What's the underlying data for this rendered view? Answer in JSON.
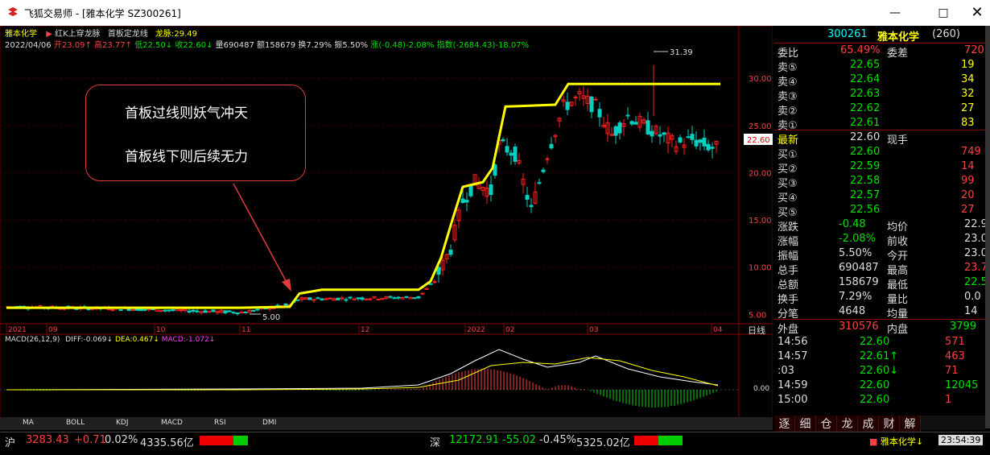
{
  "window": {
    "app_name": "飞狐交易师",
    "title": "飞狐交易师 - [雅本化学 SZ300261]",
    "min_icon": "minimize-icon",
    "max_icon": "maximize-icon",
    "close_icon": "close-icon"
  },
  "header": {
    "stock_name": "雅本化学",
    "signal1": "红K上穿龙脉",
    "signal2": "首板定龙线",
    "dragon_label": "龙脉:29.49",
    "date": "2022/04/06",
    "open": "开23.09↑",
    "high": "高23.77↑",
    "low": "低22.50↓",
    "close": "收22.60↓",
    "volume": "量690487",
    "amount": "额158679",
    "turnover": "换7.29%",
    "amplitude": "振5.50%",
    "change": "涨(-0.48)-2.08%",
    "index": "指数(-2684.43)-18.07%"
  },
  "chart": {
    "price_label": "22.60",
    "high_mark": "31.39",
    "low_mark": "5.00",
    "y_axis": [
      "30.00",
      "25.00",
      "20.00",
      "15.00",
      "10.00",
      "5.00"
    ],
    "x_axis": [
      "2021",
      "09",
      "10",
      "11",
      "12",
      "2022",
      "02",
      "03",
      "04"
    ],
    "period": "日线",
    "line_color": "#ffff00",
    "up_color": "#ff2020",
    "down_color": "#00d0c0"
  },
  "macd": {
    "label": "MACD(26,12,9)",
    "diff": "DIFF:-0.069↓",
    "dea": "DEA:0.467↓",
    "macd": "MACD:-1.072↓",
    "zero": "0.00"
  },
  "annotation": {
    "line1": "首板过线则妖气冲天",
    "line2": "首板线下则后续无力"
  },
  "indicators": [
    "MA",
    "BOLL",
    "KDJ",
    "MACD",
    "RSI",
    "DMI"
  ],
  "quote": {
    "code": "300261",
    "name": "雅本化学",
    "count": "(260)",
    "weibi_label": "委比",
    "weibi": "65.49%",
    "weicha_label": "委差",
    "weicha": "720",
    "sells": [
      {
        "label": "卖⑤",
        "price": "22.65",
        "vol": "19"
      },
      {
        "label": "卖④",
        "price": "22.64",
        "vol": "34"
      },
      {
        "label": "卖③",
        "price": "22.63",
        "vol": "32"
      },
      {
        "label": "卖②",
        "price": "22.62",
        "vol": "27"
      },
      {
        "label": "卖①",
        "price": "22.61",
        "vol": "83"
      }
    ],
    "latest_label": "最新",
    "latest": "22.60",
    "xianshou_label": "现手",
    "buys": [
      {
        "label": "买①",
        "price": "22.60",
        "vol": "749"
      },
      {
        "label": "买②",
        "price": "22.59",
        "vol": "14"
      },
      {
        "label": "买③",
        "price": "22.58",
        "vol": "99"
      },
      {
        "label": "买④",
        "price": "22.57",
        "vol": "20"
      },
      {
        "label": "买⑤",
        "price": "22.56",
        "vol": "27"
      }
    ],
    "stats": [
      {
        "l1": "涨跌",
        "v1": "-0.48",
        "l2": "均价",
        "v2": "22.9"
      },
      {
        "l1": "涨幅",
        "v1": "-2.08%",
        "l2": "前收",
        "v2": "23.0"
      },
      {
        "l1": "振幅",
        "v1": "5.50%",
        "l2": "今开",
        "v2": "23.0"
      },
      {
        "l1": "总手",
        "v1": "690487",
        "l2": "最高",
        "v2": "23.7"
      },
      {
        "l1": "总额",
        "v1": "158679",
        "l2": "最低",
        "v2": "22.5"
      },
      {
        "l1": "换手",
        "v1": "7.29%",
        "l2": "量比",
        "v2": "0.0"
      },
      {
        "l1": "分笔",
        "v1": "4648",
        "l2": "均量",
        "v2": "14"
      }
    ],
    "waipan_label": "外盘",
    "waipan": "310576",
    "neipan_label": "内盘",
    "neipan": "3799",
    "ticks": [
      {
        "time": "14:56",
        "price": "22.60",
        "vol": "571"
      },
      {
        "time": "14:57",
        "price": "22.61↑",
        "vol": "463"
      },
      {
        "time": ":03",
        "price": "22.60↓",
        "vol": "71"
      },
      {
        "time": "14:59",
        "price": "22.60",
        "vol": "12045"
      },
      {
        "time": "15:00",
        "price": "22.60",
        "vol": "1"
      }
    ],
    "tabs": [
      "逐",
      "细",
      "仓",
      "龙",
      "成",
      "财",
      "解"
    ]
  },
  "status": {
    "sh_label": "沪",
    "sh_index": "3283.43",
    "sh_change": "+0.71",
    "sh_pct": "0.02%",
    "sh_amount": "4335.56亿",
    "sz_label": "深",
    "sz_index": "12172.91",
    "sz_change": "-55.02",
    "sz_pct": "-0.45%",
    "sz_amount": "5325.02亿",
    "stock": "雅本化学↓",
    "time": "23:54:39"
  }
}
